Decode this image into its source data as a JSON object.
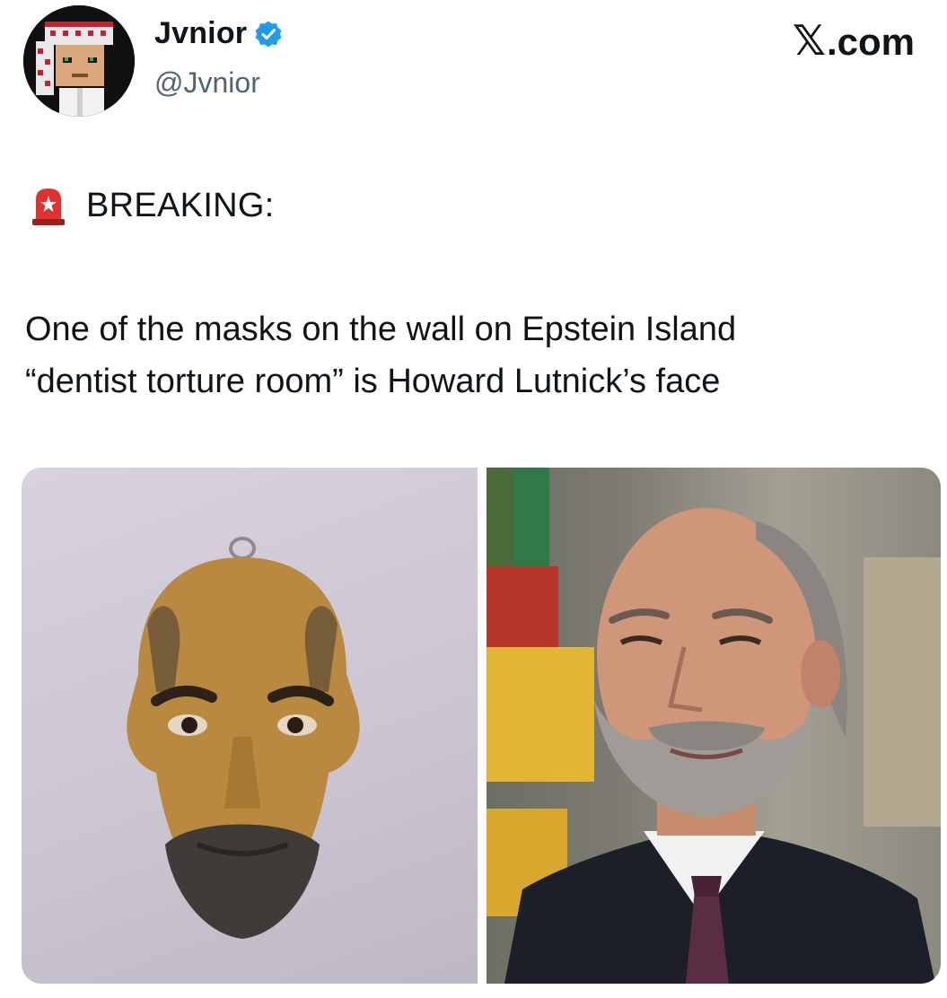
{
  "author": {
    "display_name": "Jvnior",
    "handle": "@Jvnior",
    "verified": true,
    "avatar_icon": "pixel-art-avatar-icon"
  },
  "brand": {
    "label": ".com",
    "logo_glyph": "𝕏"
  },
  "post": {
    "breaking_icon": "rotating-light-icon",
    "breaking_label": "BREAKING:",
    "text_lines": [
      "One of the masks on the wall on Epstein Island",
      "“dentist torture room” is Howard Lutnick’s face"
    ]
  },
  "media": [
    {
      "kind": "photo",
      "subject": "mask-on-wall"
    },
    {
      "kind": "photo",
      "subject": "portrait-man-in-suit"
    }
  ],
  "colors": {
    "verified_blue": "#1d9bf0",
    "siren_red": "#e0312f",
    "handle_gray": "#536471"
  }
}
